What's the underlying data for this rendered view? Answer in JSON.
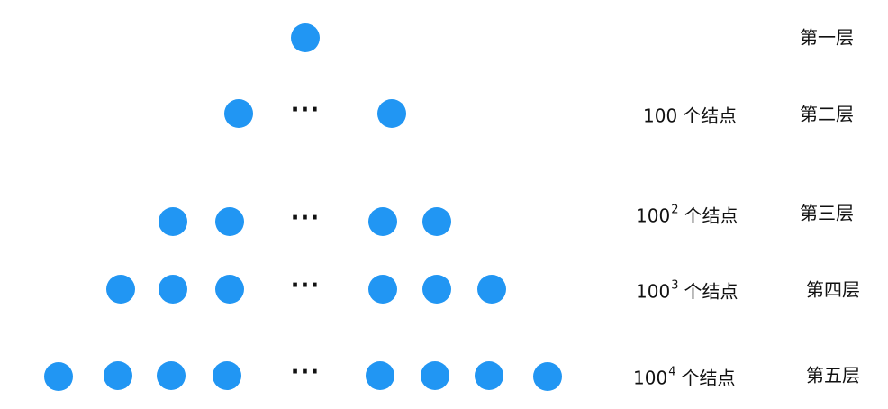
{
  "nodes_color": "#2196F3",
  "ellipsis": "···",
  "levels": [
    {
      "label": "第一层",
      "count": null
    },
    {
      "label": "第二层",
      "count": {
        "base": "100",
        "exp": "",
        "suffix": "个结点"
      }
    },
    {
      "label": "第三层",
      "count": {
        "base": "100",
        "exp": "2",
        "suffix": "个结点"
      }
    },
    {
      "label": "第四层",
      "count": {
        "base": "100",
        "exp": "3",
        "suffix": "个结点"
      }
    },
    {
      "label": "第五层",
      "count": {
        "base": "100",
        "exp": "4",
        "suffix": "个结点"
      }
    }
  ]
}
